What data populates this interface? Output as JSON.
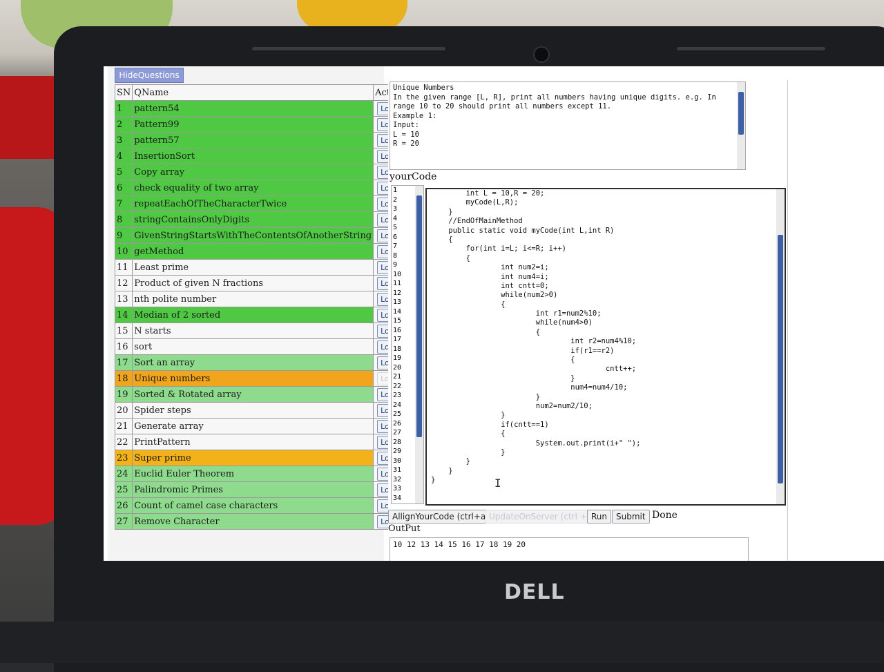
{
  "hide_button": "HideQuestions",
  "table": {
    "headers": {
      "sn": "SN",
      "name": "QName",
      "action": "Action"
    },
    "rows": [
      {
        "sn": "1",
        "name": "pattern54",
        "action": "Load",
        "status": "green"
      },
      {
        "sn": "2",
        "name": "Pattern99",
        "action": "Load",
        "status": "green"
      },
      {
        "sn": "3",
        "name": "pattern57",
        "action": "Load",
        "status": "green"
      },
      {
        "sn": "4",
        "name": "InsertionSort",
        "action": "Load",
        "status": "green"
      },
      {
        "sn": "5",
        "name": "Copy array",
        "action": "Load",
        "status": "green"
      },
      {
        "sn": "6",
        "name": "check equality of two array",
        "action": "Load",
        "status": "green"
      },
      {
        "sn": "7",
        "name": "repeatEachOfTheCharacterTwice",
        "action": "Load",
        "status": "green"
      },
      {
        "sn": "8",
        "name": "stringContainsOnlyDigits",
        "action": "Load",
        "status": "green"
      },
      {
        "sn": "9",
        "name": "GivenStringStartsWithTheContentsOfAnotherString",
        "action": "Load",
        "status": "green"
      },
      {
        "sn": "10",
        "name": "getMethod",
        "action": "Load",
        "status": "green"
      },
      {
        "sn": "11",
        "name": "Least prime",
        "action": "Load",
        "status": "white"
      },
      {
        "sn": "12",
        "name": "Product of given N fractions",
        "action": "Load",
        "status": "white"
      },
      {
        "sn": "13",
        "name": "nth polite number",
        "action": "Load",
        "status": "white"
      },
      {
        "sn": "14",
        "name": "Median of 2 sorted",
        "action": "Load",
        "status": "green"
      },
      {
        "sn": "15",
        "name": "N starts",
        "action": "Load",
        "status": "white"
      },
      {
        "sn": "16",
        "name": "sort",
        "action": "Load",
        "status": "white"
      },
      {
        "sn": "17",
        "name": "Sort an array",
        "action": "Load",
        "status": "light"
      },
      {
        "sn": "18",
        "name": "Unique numbers",
        "action": "Load",
        "status": "orange"
      },
      {
        "sn": "19",
        "name": "Sorted & Rotated array",
        "action": "Load",
        "status": "light"
      },
      {
        "sn": "20",
        "name": "Spider steps",
        "action": "Load",
        "status": "white"
      },
      {
        "sn": "21",
        "name": "Generate array",
        "action": "Load",
        "status": "white"
      },
      {
        "sn": "22",
        "name": "PrintPattern",
        "action": "Load",
        "status": "white"
      },
      {
        "sn": "23",
        "name": "Super prime",
        "action": "Load",
        "status": "amber"
      },
      {
        "sn": "24",
        "name": "Euclid Euler Theorem",
        "action": "Load",
        "status": "light"
      },
      {
        "sn": "25",
        "name": "Palindromic Primes",
        "action": "Load",
        "status": "light"
      },
      {
        "sn": "26",
        "name": "Count of camel case characters",
        "action": "Load",
        "status": "light"
      },
      {
        "sn": "27",
        "name": "Remove Character",
        "action": "Load",
        "status": "light"
      }
    ]
  },
  "question": {
    "lines": [
      "Unique Numbers",
      "In the given range [L, R], print all numbers having unique digits. e.g. In",
      "range 10 to 20 should print all numbers except 11.",
      "",
      "Example 1:",
      "",
      "Input:",
      "L = 10",
      "R = 20"
    ]
  },
  "your_code_label": "yourCode",
  "line_numbers": [
    "1",
    "2",
    "3",
    "4",
    "5",
    "6",
    "7",
    "8",
    "9",
    "10",
    "11",
    "12",
    "13",
    "14",
    "15",
    "16",
    "17",
    "18",
    "19",
    "20",
    "21",
    "22",
    "23",
    "24",
    "25",
    "26",
    "27",
    "28",
    "29",
    "30",
    "31",
    "32",
    "33",
    "34"
  ],
  "code": [
    "        int L = 10,R = 20;",
    "        myCode(L,R);",
    "    }",
    "    //EndOfMainMethod",
    "    public static void myCode(int L,int R)",
    "    {",
    "        for(int i=L; i<=R; i++)",
    "        {",
    "                int num2=i;",
    "                int num4=i;",
    "                int cntt=0;",
    "                while(num2>0)",
    "                {",
    "                        int r1=num2%10;",
    "                        while(num4>0)",
    "                        {",
    "                                int r2=num4%10;",
    "                                if(r1==r2)",
    "                                {",
    "                                        cntt++;",
    "                                }",
    "                                num4=num4/10;",
    "                        }",
    "                        num2=num2/10;",
    "                }",
    "                if(cntt==1)",
    "                {",
    "                        System.out.print(i+\" \");",
    "                }",
    "        }",
    "    }",
    "}"
  ],
  "toolbar": {
    "align": "AllignYourCode (ctrl+a)",
    "update": "UpdateOnServer (ctrl + s)",
    "run": "Run",
    "submit": "Submit",
    "status": "Done"
  },
  "output_label": "OutPut",
  "output_value": "10 12 13 14 15 16 17 18 19 20",
  "brand": "DELL"
}
